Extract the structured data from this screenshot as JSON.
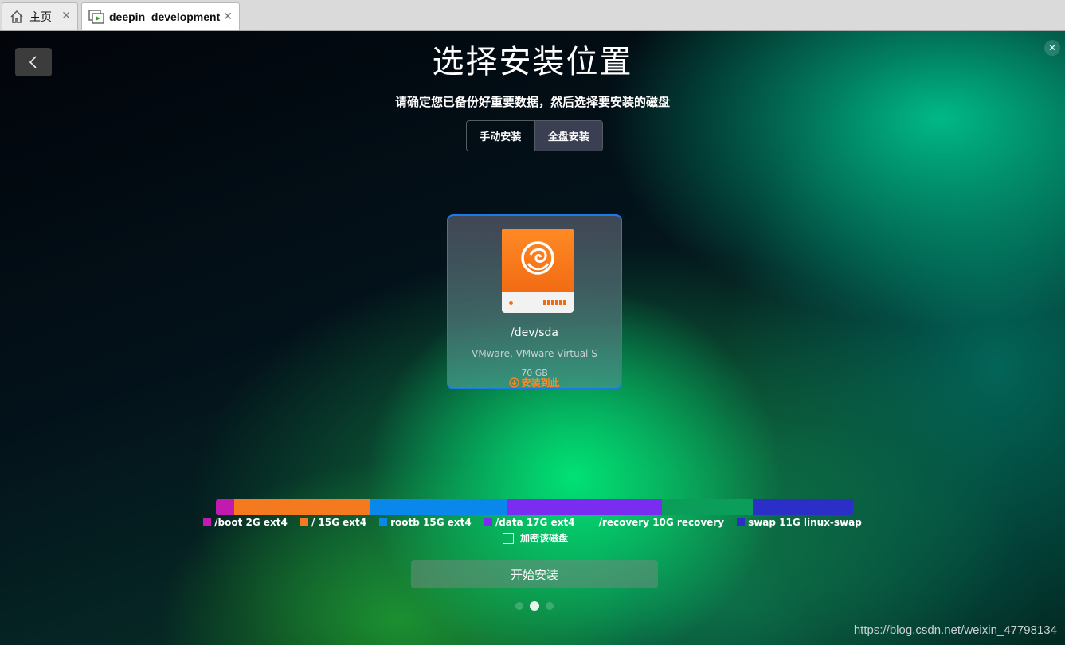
{
  "tabs": [
    {
      "label": "主页",
      "icon": "home-icon"
    },
    {
      "label": "deepin_development",
      "icon": "vm-icon"
    }
  ],
  "page": {
    "title": "选择安装位置",
    "subtitle": "请确定您已备份好重要数据，然后选择要安装的磁盘"
  },
  "mode": {
    "options": [
      "手动安装",
      "全盘安装"
    ],
    "selected": "全盘安装"
  },
  "disk": {
    "device": "/dev/sda",
    "model": "VMware, VMware Virtual S",
    "size": "70 GB",
    "install_here": "安装到此",
    "icon": "deepin-disk-icon"
  },
  "partitions": [
    {
      "label": "/boot 2G ext4",
      "size_gb": 2,
      "color": "#c01ab0"
    },
    {
      "label": "/ 15G ext4",
      "size_gb": 15,
      "color": "#f57a1f"
    },
    {
      "label": "rootb 15G ext4",
      "size_gb": 15,
      "color": "#0a87ea"
    },
    {
      "label": "/data 17G ext4",
      "size_gb": 17,
      "color": "#7a2cf0"
    },
    {
      "label": "/recovery 10G recovery",
      "size_gb": 10,
      "color": "#0a9e5a"
    },
    {
      "label": "swap 11G linux-swap",
      "size_gb": 11,
      "color": "#2b2fc8"
    }
  ],
  "encrypt_label": "加密该磁盘",
  "start_button": "开始安装",
  "pager": {
    "count": 3,
    "current": 2
  },
  "watermark": "https://blog.csdn.net/weixin_47798134"
}
